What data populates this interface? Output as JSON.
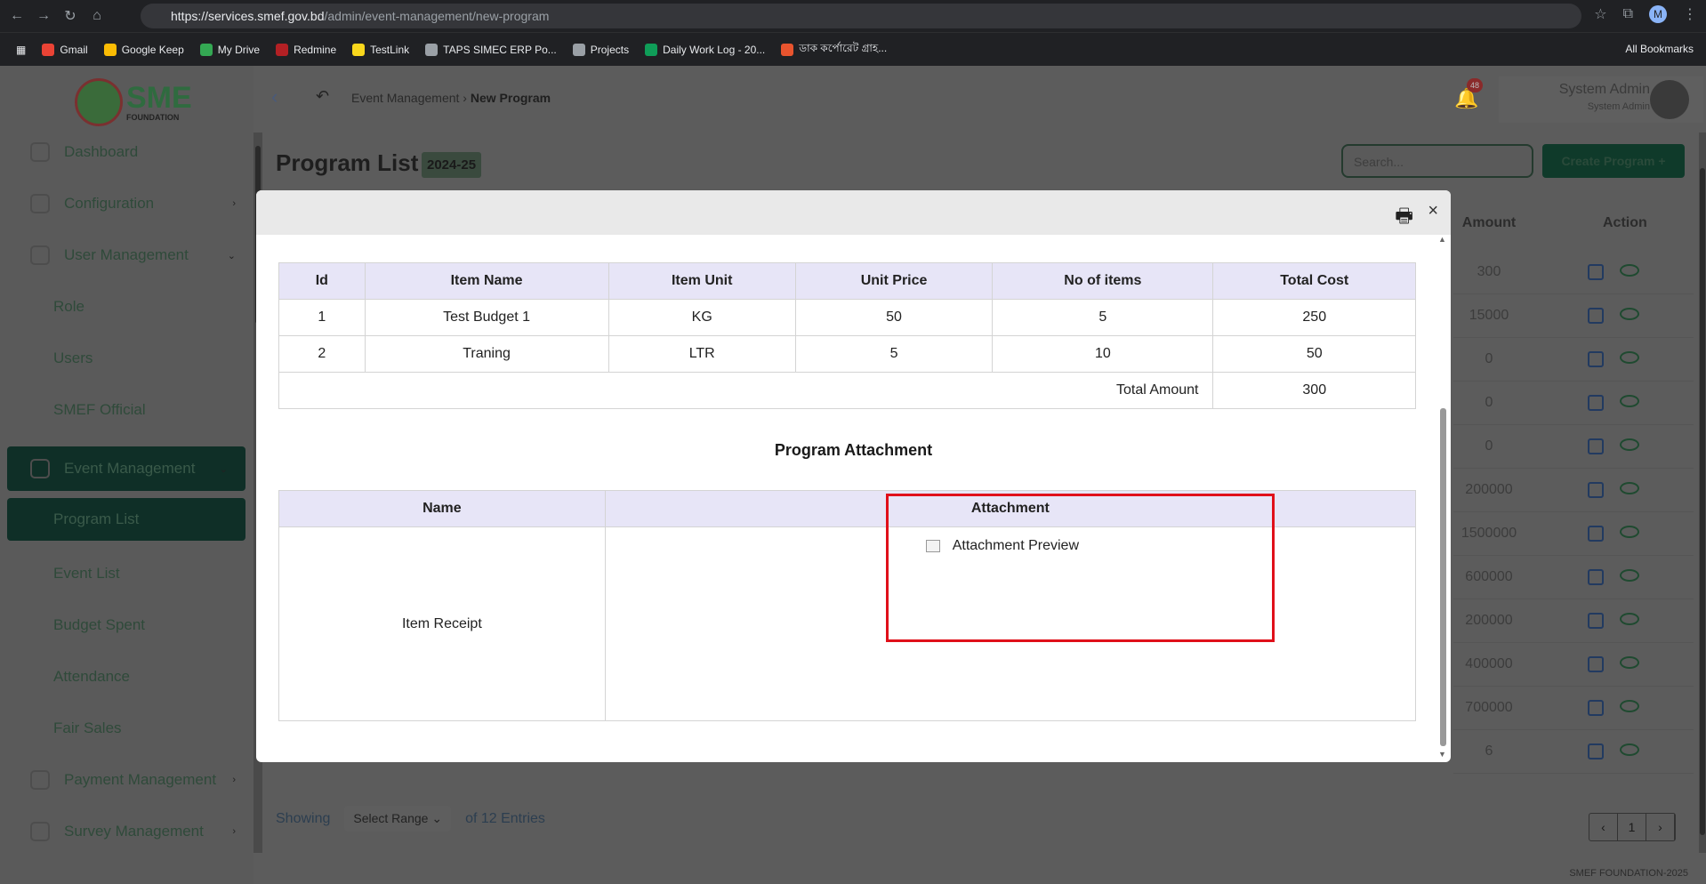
{
  "browser": {
    "url_base": "https://services.smef.gov.bd",
    "url_path": "/admin/event-management/new-program",
    "avatar_letter": "M"
  },
  "bookmarks": [
    {
      "label": "Gmail",
      "color": "#ea4335"
    },
    {
      "label": "Google Keep",
      "color": "#fbbc04"
    },
    {
      "label": "My Drive",
      "color": "#34a853"
    },
    {
      "label": "Redmine",
      "color": "#b32024"
    },
    {
      "label": "TestLink",
      "color": "#f9d71c"
    },
    {
      "label": "TAPS SIMEC ERP Po...",
      "color": "#9aa0a6"
    },
    {
      "label": "Projects",
      "color": "#9aa0a6"
    },
    {
      "label": "Daily Work Log - 20...",
      "color": "#0f9d58"
    },
    {
      "label": "ডাক কর্পোরেট গ্রাহ...",
      "color": "#e8542e"
    }
  ],
  "bookmarks_right": "All Bookmarks",
  "logo": {
    "text": "SME",
    "sub": "FOUNDATION"
  },
  "sidebar": {
    "items": [
      {
        "label": "Dashboard"
      },
      {
        "label": "Configuration"
      },
      {
        "label": "User Management"
      },
      {
        "label": "Role"
      },
      {
        "label": "Users"
      },
      {
        "label": "SMEF Official"
      },
      {
        "label": "Event Management"
      },
      {
        "label": "Program List"
      },
      {
        "label": "Event List"
      },
      {
        "label": "Budget Spent"
      },
      {
        "label": "Attendance"
      },
      {
        "label": "Fair Sales"
      },
      {
        "label": "Payment Management"
      },
      {
        "label": "Survey Management"
      }
    ]
  },
  "header": {
    "breadcrumb_parent": "Event Management",
    "breadcrumb_current": "New Program",
    "notification_count": "48",
    "user_name": "System Admin",
    "user_role": "System Admin"
  },
  "page": {
    "title": "Program List",
    "year": "2024-25",
    "search_placeholder": "Search...",
    "create_label": "Create Program +",
    "col_amount": "Amount",
    "col_action": "Action",
    "amounts": [
      "300",
      "15000",
      "0",
      "0",
      "0",
      "200000",
      "1500000",
      "600000",
      "200000",
      "400000",
      "700000",
      "6"
    ],
    "showing": "Showing",
    "select_range": "Select Range",
    "of_entries": "of 12 Entries",
    "page_number": "1",
    "copyright": "SMEF FOUNDATION-2025"
  },
  "modal": {
    "budget_headers": [
      "Id",
      "Item Name",
      "Item Unit",
      "Unit Price",
      "No of items",
      "Total Cost"
    ],
    "budget_rows": [
      [
        "1",
        "Test Budget 1",
        "KG",
        "50",
        "5",
        "250"
      ],
      [
        "2",
        "Traning",
        "LTR",
        "5",
        "10",
        "50"
      ]
    ],
    "total_label": "Total Amount",
    "total_value": "300",
    "attachment_title": "Program Attachment",
    "attach_headers": [
      "Name",
      "Attachment"
    ],
    "attach_row": {
      "name": "Item Receipt",
      "preview_alt": "Attachment Preview"
    },
    "highlight_color": "#e0101a"
  }
}
